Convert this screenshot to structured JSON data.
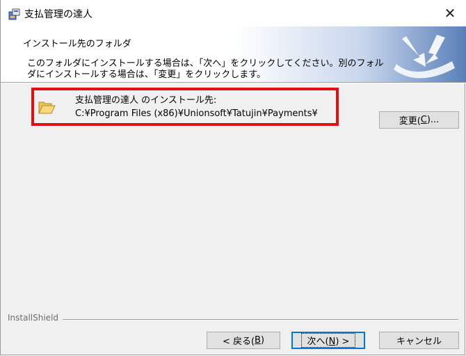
{
  "window": {
    "title": "支払管理の達人",
    "close_glyph": "✕"
  },
  "header": {
    "title": "インストール先のフォルダ",
    "description": "このフォルダにインストールする場合は、「次へ」をクリックしてください。別のフォルダにインストールする場合は、「変更」をクリックします。"
  },
  "destination": {
    "label": "支払管理の達人 のインストール先:",
    "path": "C:¥Program Files (x86)¥Unionsoft¥Tatujin¥Payments¥",
    "change_label_prefix": "変更(",
    "change_label_key": "C",
    "change_label_suffix": ")..."
  },
  "footer": {
    "brand": "InstallShield",
    "back_prefix": "< 戻る(",
    "back_key": "B",
    "back_suffix": ")",
    "next_prefix": "次へ(",
    "next_key": "N",
    "next_suffix": ") >",
    "cancel_label": "キャンセル"
  },
  "colors": {
    "highlight": "#e01010",
    "accent": "#0078d7",
    "header_logo": "#5a7fb8"
  },
  "icons": {
    "app": "installer-app-icon",
    "folder": "folder-open-icon",
    "close": "close-icon",
    "logo": "installshield-logo-icon"
  }
}
